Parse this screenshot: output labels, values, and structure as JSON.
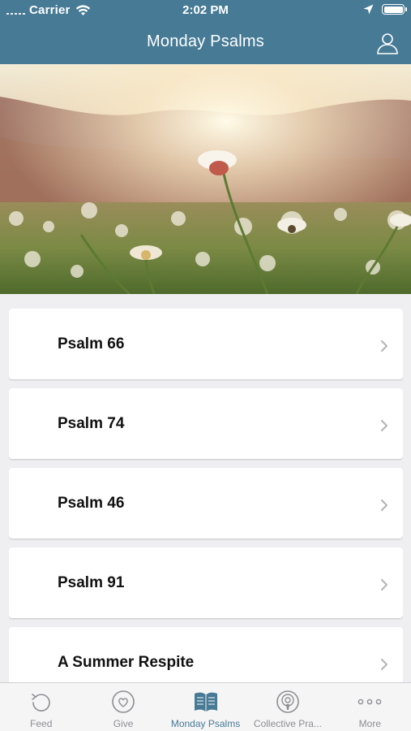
{
  "status_bar": {
    "carrier": "Carrier",
    "time": "2:02 PM"
  },
  "nav": {
    "title": "Monday Psalms",
    "profile_icon": "person-icon"
  },
  "hero": {
    "description_icon": "meadow-flowers-image"
  },
  "list": {
    "items": [
      {
        "label": "Psalm 66"
      },
      {
        "label": "Psalm 74"
      },
      {
        "label": "Psalm 46"
      },
      {
        "label": "Psalm 91"
      },
      {
        "label": "A Summer Respite"
      }
    ]
  },
  "tabbar": {
    "tabs": [
      {
        "label": "Feed",
        "icon": "refresh-icon",
        "active": false
      },
      {
        "label": "Give",
        "icon": "heart-icon",
        "active": false
      },
      {
        "label": "Monday Psalms",
        "icon": "book-icon",
        "active": true
      },
      {
        "label": "Collective Pra...",
        "icon": "podcast-icon",
        "active": false
      },
      {
        "label": "More",
        "icon": "more-icon",
        "active": false
      }
    ]
  },
  "colors": {
    "header": "#467a95",
    "accent": "#467a95",
    "background": "#efeff1",
    "inactive_tab": "#8e8e93"
  }
}
